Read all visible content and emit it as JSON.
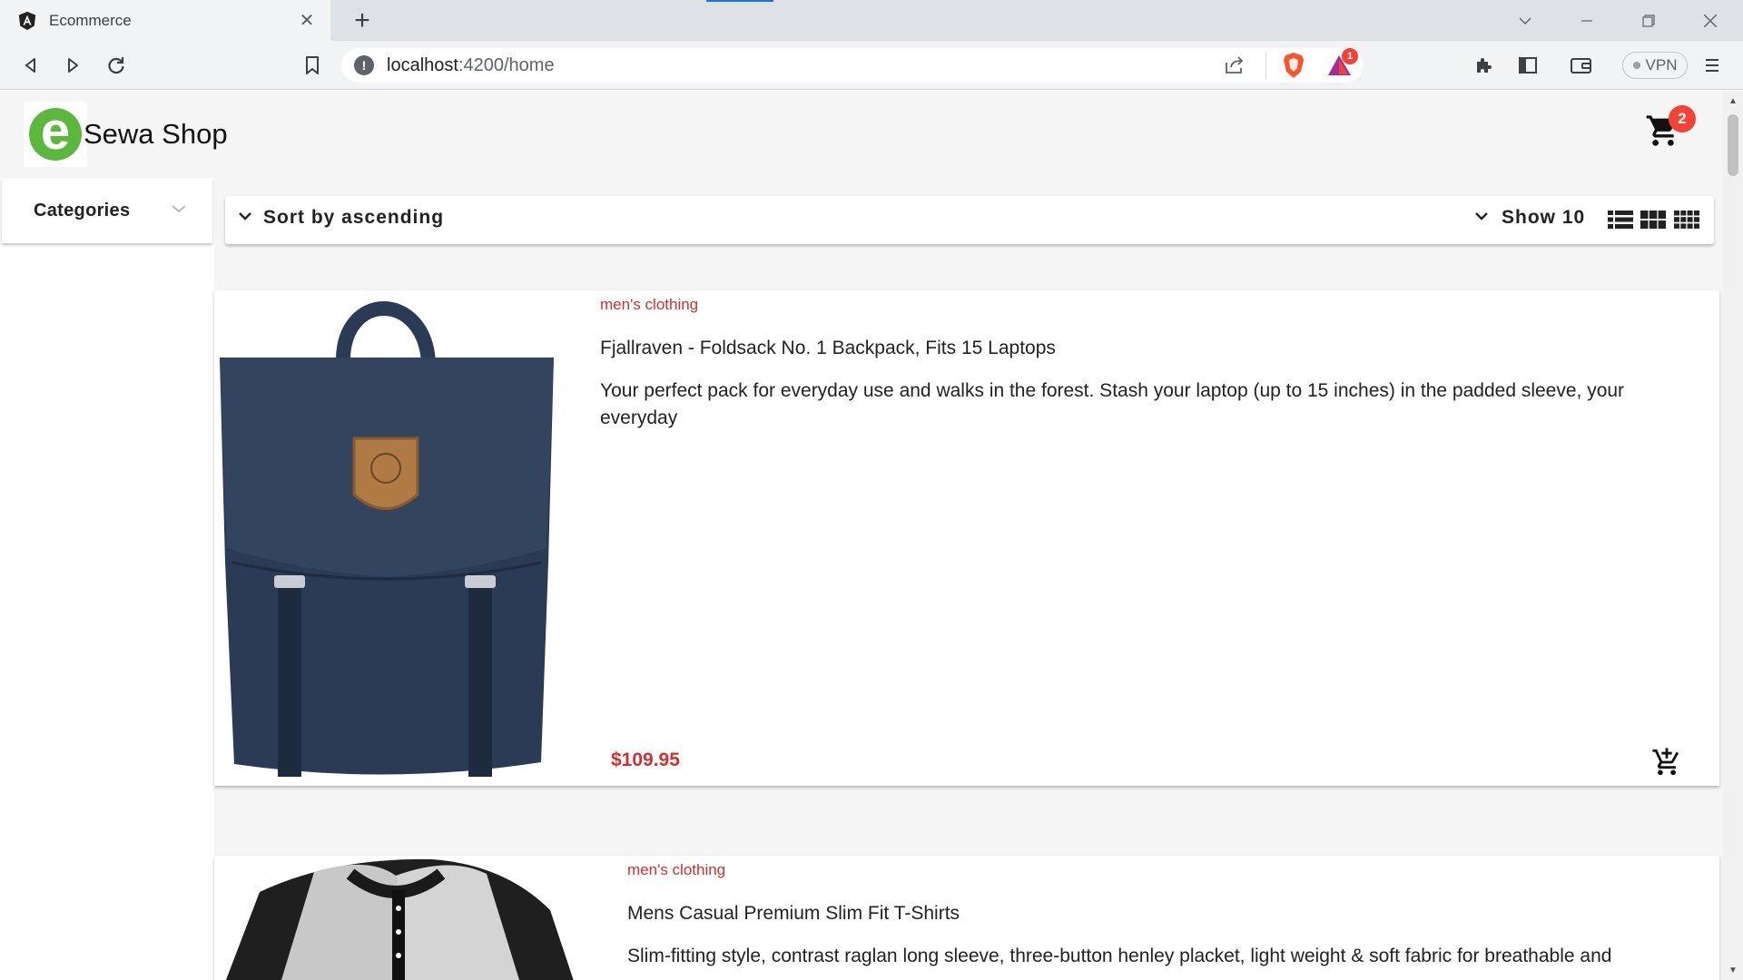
{
  "browser": {
    "tab_title": "Ecommerce",
    "url_host": "localhost",
    "url_path": ":4200/home",
    "vpn_label": "VPN",
    "rewards_badge": "1"
  },
  "header": {
    "logo_letter": "e",
    "brand": "Sewa Shop",
    "cart_count": "2"
  },
  "sidebar": {
    "categories_label": "Categories"
  },
  "sortbar": {
    "sort_label": "Sort by ascending",
    "show_label": "Show 10"
  },
  "products": [
    {
      "category": "men's clothing",
      "title": "Fjallraven - Foldsack No. 1 Backpack, Fits 15 Laptops",
      "description": "Your perfect pack for everyday use and walks in the forest. Stash your laptop (up to 15 inches) in the padded sleeve, your everyday",
      "price": "$109.95"
    },
    {
      "category": "men's clothing",
      "title": "Mens Casual Premium Slim Fit T-Shirts",
      "description": "Slim-fitting style, contrast raglan long sleeve, three-button henley placket, light weight & soft fabric for breathable and"
    }
  ],
  "colors": {
    "accent": "#d32f2f",
    "logo_green": "#5cb83d",
    "badge_red": "#f44336",
    "backpack_navy": "#2b3a55"
  }
}
